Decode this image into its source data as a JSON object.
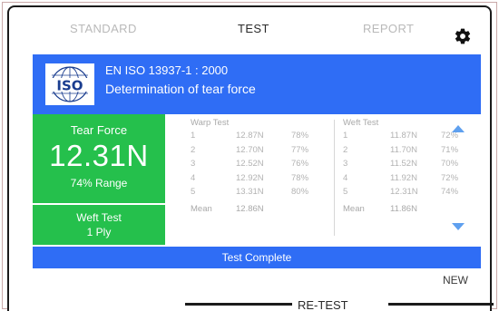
{
  "tabs": {
    "standard": "STANDARD",
    "test": "TEST",
    "report": "REPORT"
  },
  "standard_banner": {
    "logo_text": "ISO",
    "title": "EN ISO 13937-1 : 2000",
    "description": "Determination of tear force"
  },
  "tear_force": {
    "label": "Tear Force",
    "value": "12.31N",
    "range": "74% Range"
  },
  "ply": {
    "line1": "Weft Test",
    "line2": "1 Ply"
  },
  "warp": {
    "title": "Warp Test",
    "rows": [
      {
        "num": "1",
        "force": "12.87N",
        "pct": "78%"
      },
      {
        "num": "2",
        "force": "12.70N",
        "pct": "77%"
      },
      {
        "num": "3",
        "force": "12.52N",
        "pct": "76%"
      },
      {
        "num": "4",
        "force": "12.92N",
        "pct": "78%"
      },
      {
        "num": "5",
        "force": "13.31N",
        "pct": "80%"
      }
    ],
    "mean_label": "Mean",
    "mean_value": "12.86N"
  },
  "weft": {
    "title": "Weft Test",
    "rows": [
      {
        "num": "1",
        "force": "11.87N",
        "pct": "72%"
      },
      {
        "num": "2",
        "force": "11.70N",
        "pct": "71%"
      },
      {
        "num": "3",
        "force": "11.52N",
        "pct": "70%"
      },
      {
        "num": "4",
        "force": "11.92N",
        "pct": "72%"
      },
      {
        "num": "5",
        "force": "12.31N",
        "pct": "74%"
      }
    ],
    "mean_label": "Mean",
    "mean_value": "11.86N"
  },
  "status": "Test Complete",
  "actions": {
    "new": "NEW",
    "retest": "RE-TEST"
  },
  "icons": {
    "settings": "gear-icon",
    "scroll_up": "chevron-up-icon",
    "scroll_down": "chevron-down-icon",
    "logo": "iso-logo-icon"
  },
  "colors": {
    "accent_blue": "#2f6df5",
    "result_green": "#25c04c",
    "arrow_blue": "#5fa0ef"
  }
}
